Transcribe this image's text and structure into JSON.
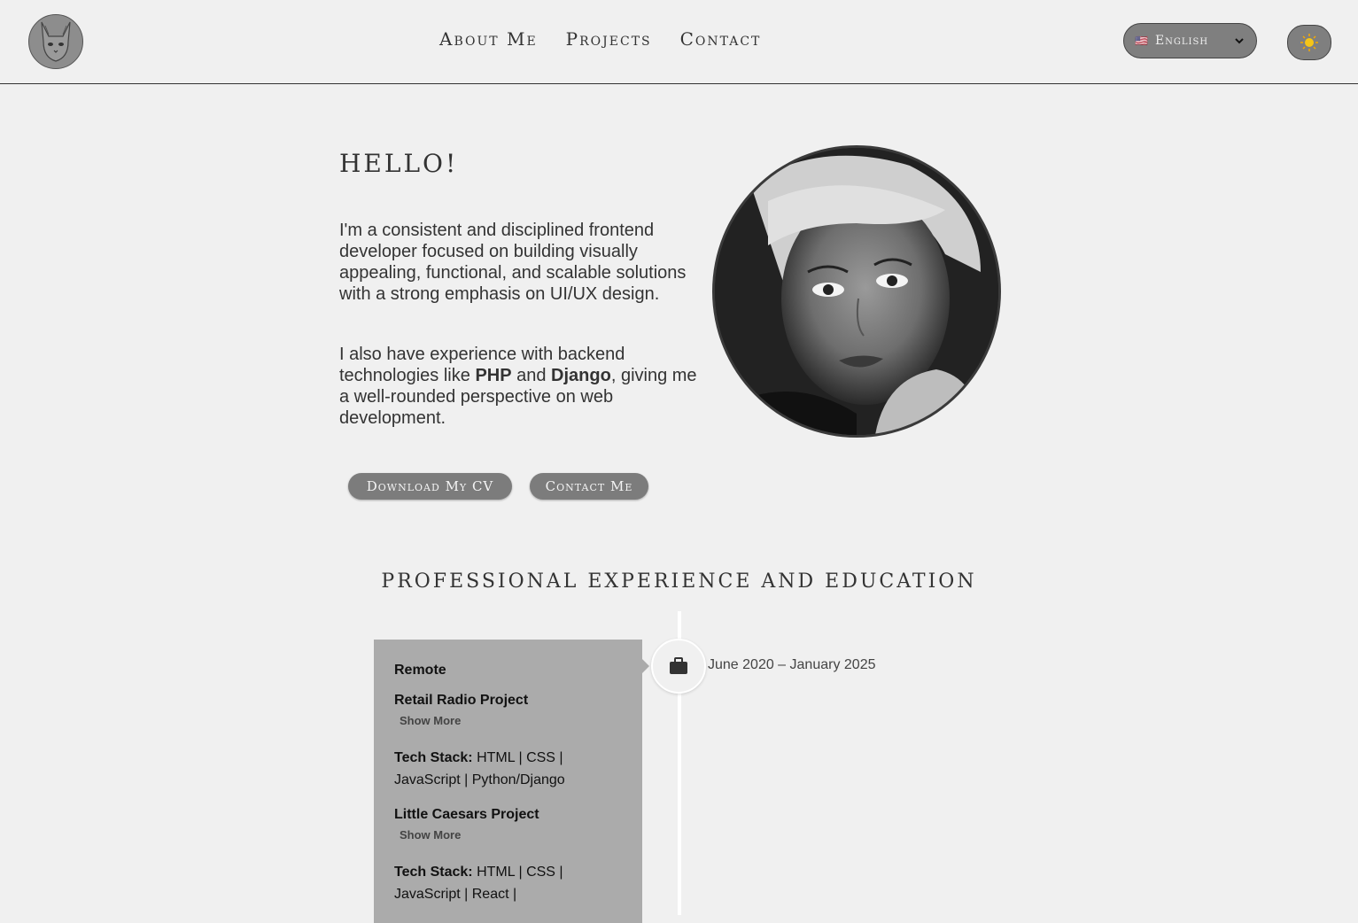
{
  "nav": {
    "items": [
      {
        "label": "About Me"
      },
      {
        "label": "Projects"
      },
      {
        "label": "Contact"
      }
    ]
  },
  "language": {
    "flag": "🇺🇸",
    "label": "English"
  },
  "theme": {
    "icon": "sun-icon"
  },
  "hero": {
    "greeting": "HELLO!",
    "paragraph1": "I'm a consistent and disciplined frontend developer focused on building visually appealing, functional, and scalable solutions with a strong emphasis on UI/UX design.",
    "p2_part1": "I also have experience with backend technologies like ",
    "p2_php": "PHP",
    "p2_and": " and ",
    "p2_django": "Django",
    "p2_part2": ", giving me a well-rounded perspective on web development.",
    "btn_cv": "Download My CV",
    "btn_contact": "Contact Me"
  },
  "experience": {
    "title": "PROFESSIONAL EXPERIENCE AND EDUCATION",
    "entries": [
      {
        "location": "Remote",
        "date": "June 2020 – January 2025",
        "icon": "briefcase-icon",
        "projects": [
          {
            "name": "Retail Radio Project",
            "show_more": "Show More",
            "stack_label": "Tech Stack:",
            "stack": " HTML | CSS | JavaScript | Python/Django"
          },
          {
            "name": "Little Caesars Project",
            "show_more": "Show More",
            "stack_label": "Tech Stack:",
            "stack": " HTML | CSS | JavaScript | React |"
          }
        ]
      }
    ]
  },
  "colors": {
    "background": "#f0f0f0",
    "button": "#7c7c7c",
    "card": "#ababab",
    "text": "#333333"
  }
}
